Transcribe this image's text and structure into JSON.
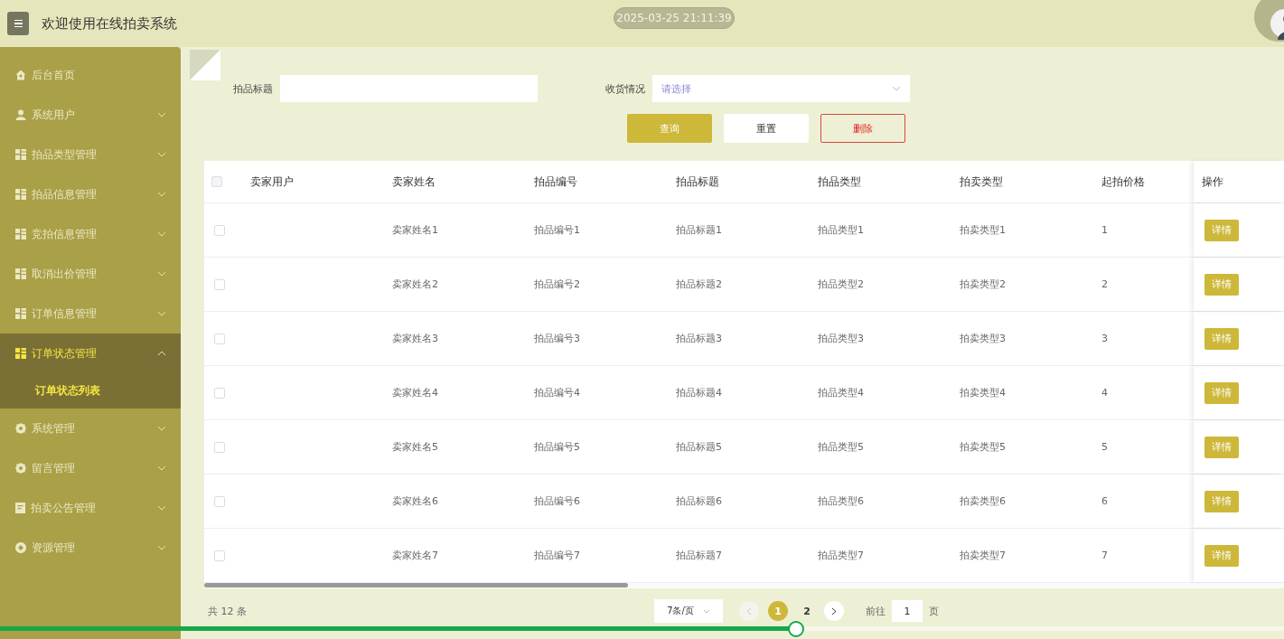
{
  "header": {
    "title": "欢迎使用在线拍卖系统",
    "datetime": "2025-03-25 21:11:39"
  },
  "sidebar": {
    "items": [
      {
        "label": "后台首页",
        "kind": "home",
        "expandable": false,
        "selected": false
      },
      {
        "label": "系统用户",
        "kind": "user",
        "expandable": true,
        "expanded": false,
        "selected": false
      },
      {
        "label": "拍品类型管理",
        "kind": "grid",
        "expandable": true,
        "expanded": false,
        "selected": false
      },
      {
        "label": "拍品信息管理",
        "kind": "grid",
        "expandable": true,
        "expanded": false,
        "selected": false
      },
      {
        "label": "竞拍信息管理",
        "kind": "grid",
        "expandable": true,
        "expanded": false,
        "selected": false
      },
      {
        "label": "取消出价管理",
        "kind": "grid",
        "expandable": true,
        "expanded": false,
        "selected": false
      },
      {
        "label": "订单信息管理",
        "kind": "grid",
        "expandable": true,
        "expanded": false,
        "selected": false
      },
      {
        "label": "订单状态管理",
        "kind": "grid",
        "expandable": true,
        "expanded": true,
        "selected": true,
        "children": [
          {
            "label": "订单状态列表",
            "selected": true
          }
        ]
      },
      {
        "label": "系统管理",
        "kind": "gear",
        "expandable": true,
        "expanded": false,
        "selected": false
      },
      {
        "label": "留言管理",
        "kind": "gear",
        "expandable": true,
        "expanded": false,
        "selected": false
      },
      {
        "label": "拍卖公告管理",
        "kind": "doc",
        "expandable": true,
        "expanded": false,
        "selected": false
      },
      {
        "label": "资源管理",
        "kind": "badge",
        "expandable": true,
        "expanded": false,
        "selected": false
      }
    ]
  },
  "filters": [
    {
      "label": "拍品标题",
      "kind": "text"
    },
    {
      "label": "收货情况",
      "kind": "select",
      "placeholder": "请选择"
    }
  ],
  "buttons": [
    {
      "label": "查询",
      "kind": "primary"
    },
    {
      "label": "重置",
      "kind": "default"
    },
    {
      "label": "删除",
      "kind": "danger"
    }
  ],
  "table": {
    "all_checked": false,
    "columns": [
      "卖家用户",
      "卖家姓名",
      "拍品编号",
      "拍品标题",
      "拍品类型",
      "拍卖类型",
      "起拍价格"
    ],
    "action_column": "操作",
    "rows": [
      {
        "checked": false,
        "cells": [
          "",
          "卖家姓名1",
          "拍品编号1",
          "拍品标题1",
          "拍品类型1",
          "拍卖类型1",
          "1"
        ],
        "action": "详情"
      },
      {
        "checked": false,
        "cells": [
          "",
          "卖家姓名2",
          "拍品编号2",
          "拍品标题2",
          "拍品类型2",
          "拍卖类型2",
          "2"
        ],
        "action": "详情"
      },
      {
        "checked": false,
        "cells": [
          "",
          "卖家姓名3",
          "拍品编号3",
          "拍品标题3",
          "拍品类型3",
          "拍卖类型3",
          "3"
        ],
        "action": "详情"
      },
      {
        "checked": false,
        "cells": [
          "",
          "卖家姓名4",
          "拍品编号4",
          "拍品标题4",
          "拍品类型4",
          "拍卖类型4",
          "4"
        ],
        "action": "详情"
      },
      {
        "checked": false,
        "cells": [
          "",
          "卖家姓名5",
          "拍品编号5",
          "拍品标题5",
          "拍品类型5",
          "拍卖类型5",
          "5"
        ],
        "action": "详情"
      },
      {
        "checked": false,
        "cells": [
          "",
          "卖家姓名6",
          "拍品编号6",
          "拍品标题6",
          "拍品类型6",
          "拍卖类型6",
          "6"
        ],
        "action": "详情"
      },
      {
        "checked": false,
        "cells": [
          "",
          "卖家姓名7",
          "拍品编号7",
          "拍品标题7",
          "拍品类型7",
          "拍卖类型7",
          "7"
        ],
        "action": "详情"
      }
    ]
  },
  "pagination": {
    "total": "共 12 条",
    "page_size": "7条/页",
    "pages": [
      {
        "label": "1",
        "selected": true
      },
      {
        "label": "2",
        "selected": false
      }
    ],
    "goto_label": "前往",
    "goto_value": "1",
    "goto_suffix": "页"
  },
  "video_progress": {
    "level": 0.62
  }
}
